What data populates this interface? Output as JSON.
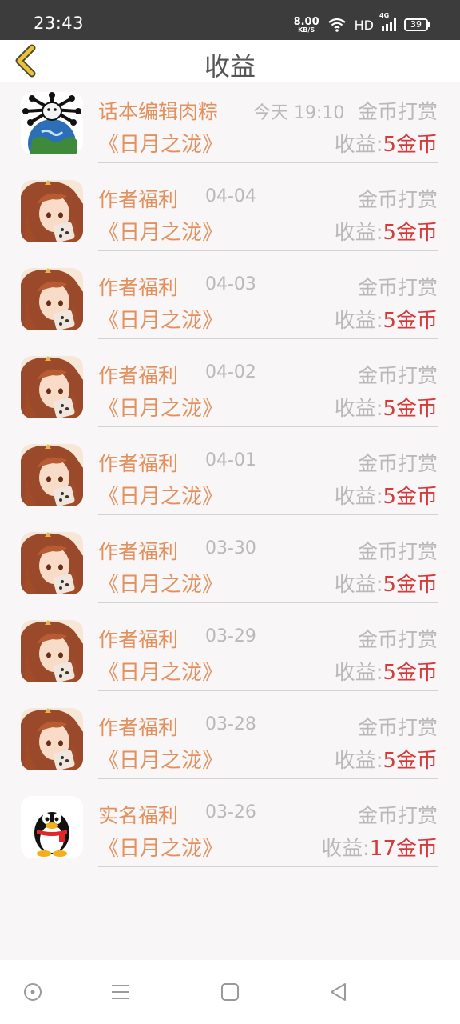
{
  "status_bar": {
    "time": "23:43",
    "net_speed": "8.00",
    "net_unit": "KB/S",
    "wifi_icon": "wifi-icon",
    "hd": "HD",
    "network_type": "4G",
    "battery": "39"
  },
  "header": {
    "title": "收益",
    "back_icon": "chevron-left-icon"
  },
  "colors": {
    "accent_orange": "#e3905c",
    "amount_red": "#d53b3b",
    "muted_gray": "#b9b9b9",
    "background": "#f8f6f7"
  },
  "records": [
    {
      "name": "话本编辑肉粽",
      "date": "今天 19:10",
      "type": "金币打赏",
      "book": "《日月之泷》",
      "earn_label": "收益:",
      "amount": "5金币",
      "avatar": "editor-avatar"
    },
    {
      "name": "作者福利",
      "date": "04-04",
      "type": "金币打赏",
      "book": "《日月之泷》",
      "earn_label": "收益:",
      "amount": "5金币",
      "avatar": "anime-girl-avatar"
    },
    {
      "name": "作者福利",
      "date": "04-03",
      "type": "金币打赏",
      "book": "《日月之泷》",
      "earn_label": "收益:",
      "amount": "5金币",
      "avatar": "anime-girl-avatar"
    },
    {
      "name": "作者福利",
      "date": "04-02",
      "type": "金币打赏",
      "book": "《日月之泷》",
      "earn_label": "收益:",
      "amount": "5金币",
      "avatar": "anime-girl-avatar"
    },
    {
      "name": "作者福利",
      "date": "04-01",
      "type": "金币打赏",
      "book": "《日月之泷》",
      "earn_label": "收益:",
      "amount": "5金币",
      "avatar": "anime-girl-avatar"
    },
    {
      "name": "作者福利",
      "date": "03-30",
      "type": "金币打赏",
      "book": "《日月之泷》",
      "earn_label": "收益:",
      "amount": "5金币",
      "avatar": "anime-girl-avatar"
    },
    {
      "name": "作者福利",
      "date": "03-29",
      "type": "金币打赏",
      "book": "《日月之泷》",
      "earn_label": "收益:",
      "amount": "5金币",
      "avatar": "anime-girl-avatar"
    },
    {
      "name": "作者福利",
      "date": "03-28",
      "type": "金币打赏",
      "book": "《日月之泷》",
      "earn_label": "收益:",
      "amount": "5金币",
      "avatar": "anime-girl-avatar"
    },
    {
      "name": "实名福利",
      "date": "03-26",
      "type": "金币打赏",
      "book": "《日月之泷》",
      "earn_label": "收益:",
      "amount": "17金币",
      "avatar": "qq-penguin-avatar"
    }
  ],
  "nav_bar": {
    "buttons": [
      "assistant-circle-icon",
      "menu-lines-icon",
      "home-square-icon",
      "back-triangle-icon"
    ]
  }
}
